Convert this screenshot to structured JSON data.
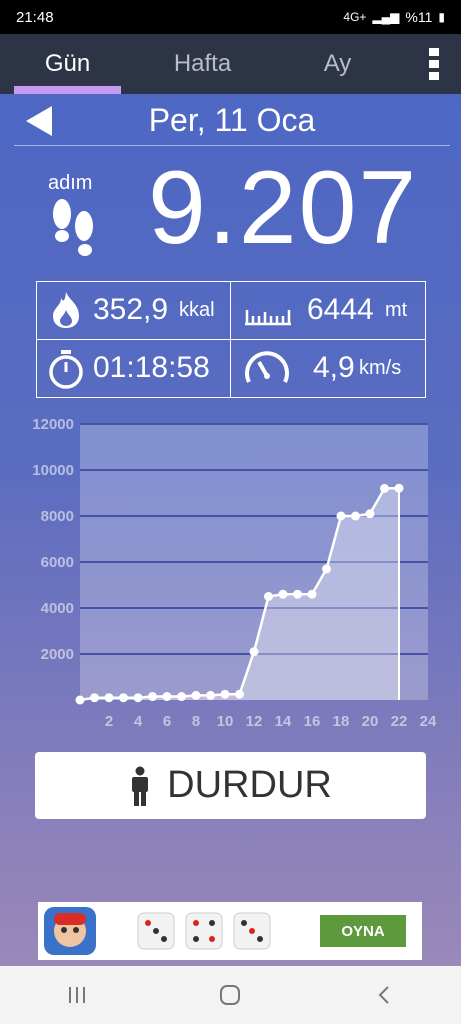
{
  "status_bar": {
    "time": "21:48",
    "network": "4G+",
    "battery": "%11"
  },
  "tabs": [
    {
      "label": "Gün",
      "active": true
    },
    {
      "label": "Hafta",
      "active": false
    },
    {
      "label": "Ay",
      "active": false
    }
  ],
  "date": "Per, 11 Oca",
  "steps": {
    "label": "adım",
    "value": "9.207"
  },
  "stats": {
    "calories": {
      "value": "352,9",
      "unit": "kkal"
    },
    "distance": {
      "value": "6444",
      "unit": "mt"
    },
    "duration": {
      "value": "01:18:58"
    },
    "speed": {
      "value": "4,9",
      "unit": "km/s"
    }
  },
  "chart_data": {
    "type": "area",
    "x": [
      0,
      1,
      2,
      3,
      4,
      5,
      6,
      7,
      8,
      9,
      10,
      11,
      12,
      13,
      14,
      15,
      16,
      17,
      18,
      19,
      20,
      21,
      22
    ],
    "y": [
      0,
      100,
      100,
      100,
      100,
      150,
      150,
      150,
      200,
      200,
      250,
      250,
      2100,
      4500,
      4600,
      4600,
      4600,
      5700,
      8000,
      8000,
      8100,
      9200,
      9207
    ],
    "xticks": [
      2,
      4,
      6,
      8,
      10,
      12,
      14,
      16,
      18,
      20,
      22,
      24
    ],
    "yticks": [
      2000,
      4000,
      6000,
      8000,
      10000,
      12000
    ],
    "xlim": [
      0,
      24
    ],
    "ylim": [
      0,
      12000
    ],
    "grid": true
  },
  "stop_button": {
    "label": "DURDUR"
  },
  "ad": {
    "button_label": "OYNA"
  },
  "colors": {
    "active_tab_indicator": "#c79cf0",
    "ad_button": "#5c9a3d"
  }
}
